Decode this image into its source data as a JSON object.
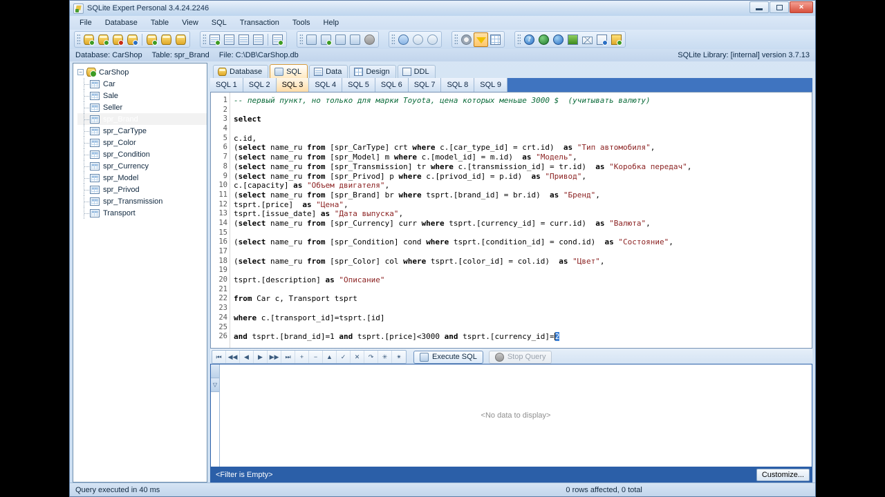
{
  "window": {
    "title": "SQLite Expert Personal 3.4.24.2246",
    "app_icon": "sqlite-expert-icon",
    "minimize_label": "Minimize",
    "maximize_label": "Maximize",
    "close_label": "Close"
  },
  "menu": [
    {
      "label": "File",
      "accel": "F"
    },
    {
      "label": "Database",
      "accel": "D"
    },
    {
      "label": "Table",
      "accel": "T"
    },
    {
      "label": "View",
      "accel": "V"
    },
    {
      "label": "SQL",
      "accel": "S"
    },
    {
      "label": "Transaction",
      "accel": "r"
    },
    {
      "label": "Tools",
      "accel": "o"
    },
    {
      "label": "Help",
      "accel": "H"
    }
  ],
  "toolbar": {
    "groups": [
      {
        "name": "database-group",
        "buttons": [
          {
            "name": "open-database-button",
            "icon": "database-open-icon"
          },
          {
            "name": "new-database-button",
            "icon": "database-add-icon"
          },
          {
            "name": "remove-database-button",
            "icon": "database-remove-icon"
          },
          {
            "name": "database-properties-button",
            "icon": "database-settings-icon"
          },
          {
            "name": "separator",
            "icon": "separator"
          },
          {
            "name": "attach-database-button",
            "icon": "database-attach-icon"
          },
          {
            "name": "detach-database-button",
            "icon": "database-detach-icon"
          },
          {
            "name": "backup-database-button",
            "icon": "database-backup-icon"
          }
        ]
      },
      {
        "name": "object-group",
        "buttons": [
          {
            "name": "new-table-button",
            "icon": "table-new-icon"
          },
          {
            "name": "new-view-button",
            "icon": "view-new-icon"
          },
          {
            "name": "new-index-button",
            "icon": "index-new-icon"
          },
          {
            "name": "new-trigger-button",
            "icon": "trigger-new-icon"
          },
          {
            "name": "separator",
            "icon": "separator"
          },
          {
            "name": "design-table-button",
            "icon": "table-design-icon"
          }
        ]
      },
      {
        "name": "query-group",
        "buttons": [
          {
            "name": "run-query-button",
            "icon": "runner-run-icon"
          },
          {
            "name": "run-script-button",
            "icon": "runner-script-icon"
          },
          {
            "name": "save-query-button",
            "icon": "runner-save-icon"
          },
          {
            "name": "clear-query-button",
            "icon": "runner-clear-icon"
          },
          {
            "name": "cancel-query-button",
            "icon": "cancel-circle-icon"
          }
        ]
      },
      {
        "name": "transaction-group",
        "buttons": [
          {
            "name": "begin-transaction-button",
            "icon": "play-circle-icon"
          },
          {
            "name": "commit-transaction-button",
            "icon": "check-circle-icon"
          },
          {
            "name": "rollback-transaction-button",
            "icon": "rollback-circle-icon"
          }
        ]
      },
      {
        "name": "view-options-group",
        "buttons": [
          {
            "name": "options-button",
            "icon": "gear-icon"
          },
          {
            "name": "filter-button",
            "icon": "funnel-icon",
            "active": true
          },
          {
            "name": "grid-layout-button",
            "icon": "grid-icon"
          }
        ]
      },
      {
        "name": "help-group",
        "buttons": [
          {
            "name": "help-button",
            "icon": "help-icon"
          },
          {
            "name": "home-page-button",
            "icon": "globe-home-icon"
          },
          {
            "name": "web-site-button",
            "icon": "web-icon"
          },
          {
            "name": "register-button",
            "icon": "pen-icon"
          },
          {
            "name": "contact-button",
            "icon": "mail-icon"
          },
          {
            "name": "readme-button",
            "icon": "document-info-icon"
          },
          {
            "name": "about-button",
            "icon": "about-icon"
          }
        ]
      }
    ]
  },
  "infobar": {
    "database": "Database: CarShop",
    "table": "Table: spr_Brand",
    "file": "File: C:\\DB\\CarShop.db",
    "library": "SQLite Library: [internal] version 3.7.13"
  },
  "tree": {
    "root": {
      "label": "CarShop",
      "expander": "−"
    },
    "items": [
      {
        "label": "Car",
        "selected": false
      },
      {
        "label": "Sale",
        "selected": false
      },
      {
        "label": "Seller",
        "selected": false
      },
      {
        "label": "spr_Brand",
        "selected": true
      },
      {
        "label": "spr_CarType",
        "selected": false
      },
      {
        "label": "spr_Color",
        "selected": false
      },
      {
        "label": "spr_Condition",
        "selected": false
      },
      {
        "label": "spr_Currency",
        "selected": false
      },
      {
        "label": "spr_Model",
        "selected": false
      },
      {
        "label": "spr_Privod",
        "selected": false
      },
      {
        "label": "spr_Transmission",
        "selected": false
      },
      {
        "label": "Transport",
        "selected": false
      }
    ]
  },
  "main_tabs": [
    {
      "label": "Database",
      "icon": "database-tab-icon",
      "active": false
    },
    {
      "label": "SQL",
      "icon": "sql-tab-icon",
      "active": true
    },
    {
      "label": "Data",
      "icon": "data-tab-icon",
      "active": false
    },
    {
      "label": "Design",
      "icon": "design-tab-icon",
      "active": false
    },
    {
      "label": "DDL",
      "icon": "ddl-tab-icon",
      "active": false
    }
  ],
  "sql_tabs": [
    {
      "label": "SQL 1",
      "active": false
    },
    {
      "label": "SQL 2",
      "active": false
    },
    {
      "label": "SQL 3",
      "active": true
    },
    {
      "label": "SQL 4",
      "active": false
    },
    {
      "label": "SQL 5",
      "active": false
    },
    {
      "label": "SQL 6",
      "active": false
    },
    {
      "label": "SQL 7",
      "active": false
    },
    {
      "label": "SQL 8",
      "active": false
    },
    {
      "label": "SQL 9",
      "active": false
    }
  ],
  "editor": {
    "line_count": 26,
    "selection": "2",
    "lines": [
      "-- первый пункт, но только для марки Toyota, цена которых меньше 3000 $  (учитывать валюту)",
      "",
      "select",
      "",
      "c.id,",
      "(select name_ru from [spr_CarType] crt where c.[car_type_id] = crt.id)  as \"Тип автомобиля\",",
      "(select name_ru from [spr_Model] m where c.[model_id] = m.id)  as \"Модель\",",
      "(select name_ru from [spr_Transmission] tr where c.[transmission_id] = tr.id)  as \"Коробка передач\",",
      "(select name_ru from [spr_Privod] p where c.[privod_id] = p.id)  as \"Привод\",",
      "c.[capacity] as \"Объем двигателя\",",
      "(select name_ru from [spr_Brand] br where tsprt.[brand_id] = br.id)  as \"Бренд\",",
      "tsprt.[price]  as \"Цена\",",
      "tsprt.[issue_date] as \"Дата выпуска\",",
      "(select name_ru from [spr_Currency] curr where tsprt.[currency_id] = curr.id)  as \"Валюта\",",
      "",
      "(select name_ru from [spr_Condition] cond where tsprt.[condition_id] = cond.id)  as \"Состояние\",",
      "",
      "(select name_ru from [spr_Color] col where tsprt.[color_id] = col.id)  as \"Цвет\",",
      "",
      "tsprt.[description] as \"Описание\"",
      "",
      "from Car c, Transport tsprt",
      "",
      "where c.[transport_id]=tsprt.[id]",
      "",
      "and tsprt.[brand_id]=1 and tsprt.[price]<3000 and tsprt.[currency_id]=2"
    ]
  },
  "nav_toolbar": {
    "buttons": [
      {
        "name": "first-record-button",
        "glyph": "⏮"
      },
      {
        "name": "prior-page-button",
        "glyph": "◀◀"
      },
      {
        "name": "prior-record-button",
        "glyph": "◀"
      },
      {
        "name": "next-record-button",
        "glyph": "▶"
      },
      {
        "name": "next-page-button",
        "glyph": "▶▶"
      },
      {
        "name": "last-record-button",
        "glyph": "⏭"
      },
      {
        "name": "insert-record-button",
        "glyph": "+"
      },
      {
        "name": "delete-record-button",
        "glyph": "−"
      },
      {
        "name": "edit-record-button",
        "glyph": "▲"
      },
      {
        "name": "post-edit-button",
        "glyph": "✓"
      },
      {
        "name": "cancel-edit-button",
        "glyph": "✕"
      },
      {
        "name": "refresh-button",
        "glyph": "↷"
      },
      {
        "name": "set-null-button",
        "glyph": "✳"
      },
      {
        "name": "clear-null-button",
        "glyph": "✴"
      }
    ],
    "execute_label": "Execute SQL",
    "execute_icon": "runner-run-icon",
    "stop_label": "Stop Query",
    "stop_icon": "stop-circle-icon"
  },
  "results": {
    "empty_message": "<No data to display>",
    "filter_text": "<Filter is Empty>",
    "customize_label": "Customize...",
    "indicator_icon": "filter-indicator-icon"
  },
  "statusbar": {
    "left": "Query executed in 40 ms",
    "center": "0 rows affected, 0 total"
  },
  "colors": {
    "accent_blue": "#2b5fa8",
    "active_tab": "#ffdca6",
    "selection": "#3a7fd5",
    "comment": "#0b6b3a",
    "string": "#8a1f1f"
  }
}
